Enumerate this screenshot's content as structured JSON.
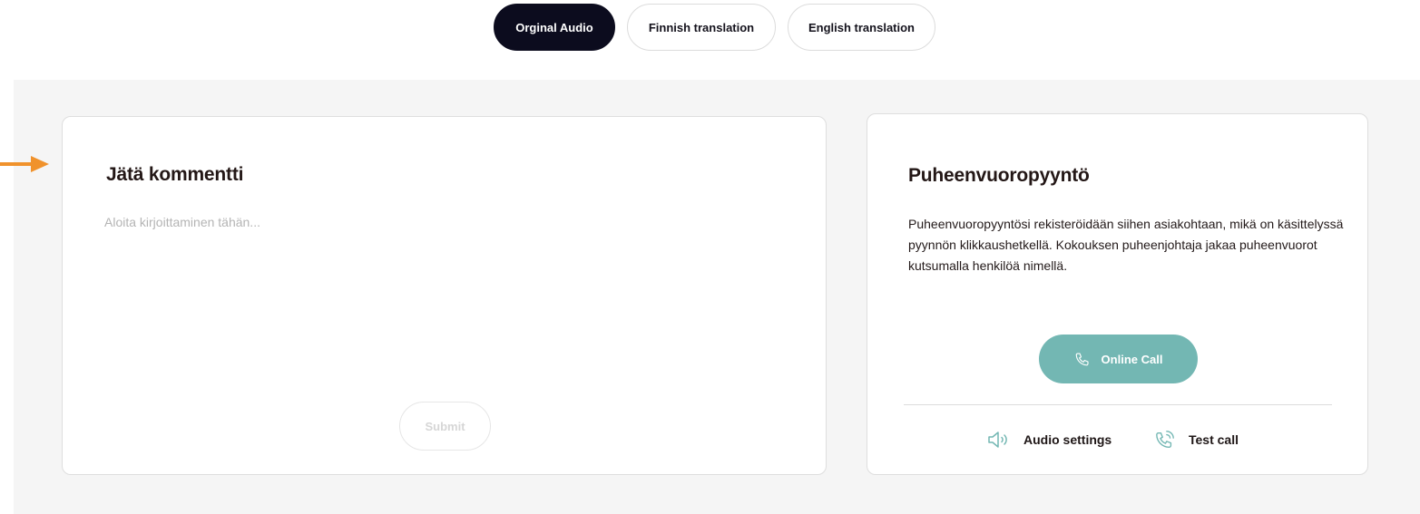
{
  "tabs": [
    {
      "label": "Orginal Audio",
      "active": true
    },
    {
      "label": "Finnish translation",
      "active": false
    },
    {
      "label": "English translation",
      "active": false
    }
  ],
  "colors": {
    "accent_dark": "#0c0c1e",
    "call_button": "#73b7b3",
    "annotation_arrow": "#f0922c",
    "stage_background": "#f5f5f5"
  },
  "comment": {
    "title": "Jätä kommentti",
    "placeholder": "Aloita kirjoittaminen tähän...",
    "submit_label": "Submit"
  },
  "speech_request": {
    "title": "Puheenvuoropyyntö",
    "description": "Puheenvuoropyyntösi rekisteröidään siihen asiakohtaan, mikä on käsittelyssä pyynnön klikkaushetkellä. Kokouksen puheenjohtaja jakaa puheenvuorot kutsumalla henkilöä nimellä.",
    "call_button_label": "Online Call",
    "audio_settings_label": "Audio settings",
    "test_call_label": "Test call"
  },
  "icons": {
    "annotation": "arrow-right-icon",
    "call": "phone-icon",
    "audio": "speaker-icon",
    "test": "phone-ringing-icon"
  }
}
